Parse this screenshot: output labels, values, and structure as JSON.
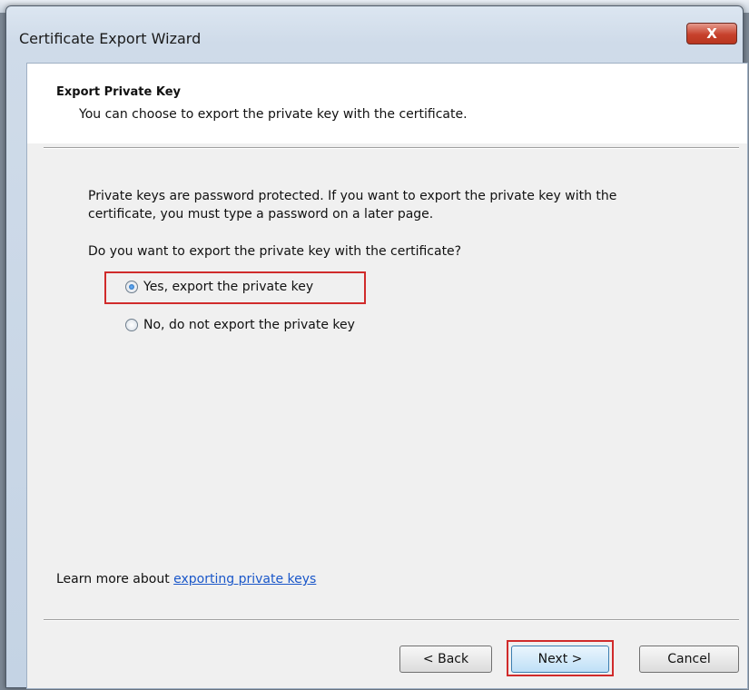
{
  "window": {
    "title": "Certificate Export Wizard",
    "close_glyph": "X"
  },
  "header": {
    "title": "Export Private Key",
    "subtitle": "You can choose to export the private key with the certificate."
  },
  "body": {
    "paragraph_line1": "Private keys are password protected. If you want to export the private key with the",
    "paragraph_line2": "certificate, you must type a password on a later page.",
    "question": "Do you want to export the private key with the certificate?",
    "options": [
      {
        "label": "Yes, export the private key",
        "selected": true
      },
      {
        "label": "No, do not export the private key",
        "selected": false
      }
    ]
  },
  "footer": {
    "learn_prefix": "Learn more about ",
    "learn_link": "exporting private keys"
  },
  "buttons": {
    "back": "< Back",
    "next": "Next >",
    "cancel": "Cancel"
  },
  "colors": {
    "highlight": "#d02b2b",
    "link": "#1a57c9"
  }
}
